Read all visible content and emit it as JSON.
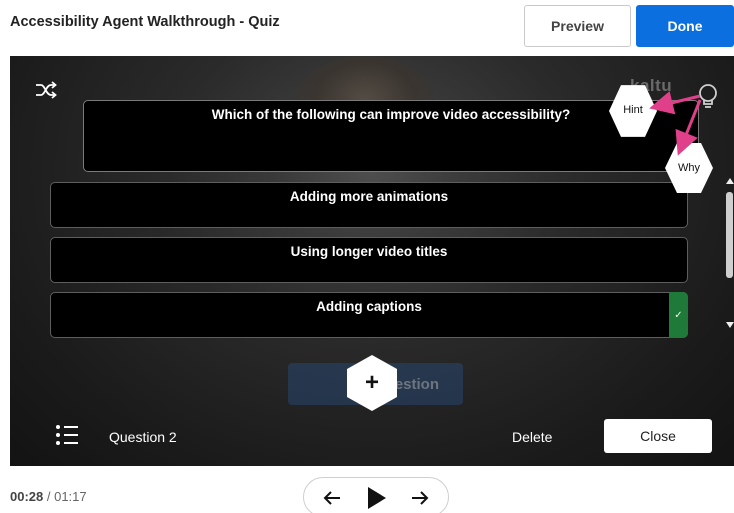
{
  "header": {
    "title": "Accessibility Agent Walkthrough - Quiz",
    "preview_label": "Preview",
    "done_label": "Done"
  },
  "player": {
    "logo_text": "kaltu",
    "watermark_text": "uestion",
    "question": "Which of the following can improve video accessibility?",
    "answers": [
      {
        "text": "Adding more animations",
        "correct": false
      },
      {
        "text": "Using longer video titles",
        "correct": false
      },
      {
        "text": "Adding captions",
        "correct": true
      }
    ],
    "hint_label": "Hint",
    "why_label": "Why",
    "add_symbol": "+",
    "question_number": "Question 2",
    "delete_label": "Delete",
    "close_label": "Close"
  },
  "playback": {
    "current_time": "00:28",
    "separator": " / ",
    "total_time": "01:17"
  },
  "colors": {
    "accent": "#0b6fe0",
    "correct": "#1f7a3a",
    "annotation_arrow": "#e0408a"
  },
  "icons": [
    "shuffle-icon",
    "lightbulb-icon",
    "list-icon",
    "add-icon",
    "check-icon",
    "arrow-left-icon",
    "play-icon",
    "arrow-right-icon"
  ]
}
